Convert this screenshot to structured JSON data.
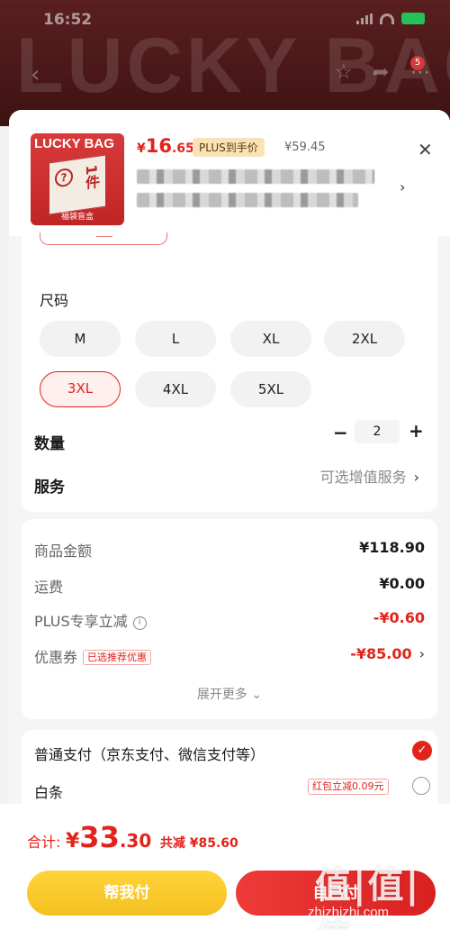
{
  "status_bar": {
    "time": "16:52",
    "battery_color": "#25c25a"
  },
  "hero": {
    "banner_text": "LUCKY BAG",
    "cart_badge": "5"
  },
  "product": {
    "thumb_title": "LUCKY BAG",
    "thumb_foot": "福袋盲盒",
    "thumb_piece": "1件",
    "price_currency": "¥",
    "price_int": "16",
    "price_dec": ".65",
    "plus_tag": "PLUS到手价",
    "original_price": "¥59.45"
  },
  "specs": {
    "size_label": "尺码",
    "sizes": [
      "M",
      "L",
      "XL",
      "2XL",
      "3XL",
      "4XL",
      "5XL"
    ],
    "selected_size": "3XL",
    "quantity_label": "数量",
    "quantity": "2",
    "minus": "−",
    "plus": "+",
    "service_label": "服务",
    "service_value": "可选增值服务"
  },
  "fees": {
    "goods_label": "商品金额",
    "goods_value": "¥118.90",
    "shipping_label": "运费",
    "shipping_value": "¥0.00",
    "plus_label": "PLUS专享立减",
    "plus_value": "-¥0.60",
    "coupon_label": "优惠券",
    "coupon_tag": "已选推荐优惠",
    "coupon_value": "-¥85.00",
    "expand_label": "展开更多"
  },
  "payment": {
    "normal_label": "普通支付（京东支付、微信支付等）",
    "baitiao_label": "白条",
    "baitiao_tag": "红包立减0.09元"
  },
  "footer": {
    "total_label": "合计:",
    "total_currency": "¥",
    "total_int": "33",
    "total_dec": ".30",
    "saved": "共减 ¥85.60",
    "help_pay": "帮我付",
    "pay_button": "自己付"
  },
  "watermark": {
    "logo": "值|值|值",
    "url": "zhizhizhi.com"
  },
  "colors": {
    "accent": "#e2231a",
    "gold": "#f4c020"
  }
}
